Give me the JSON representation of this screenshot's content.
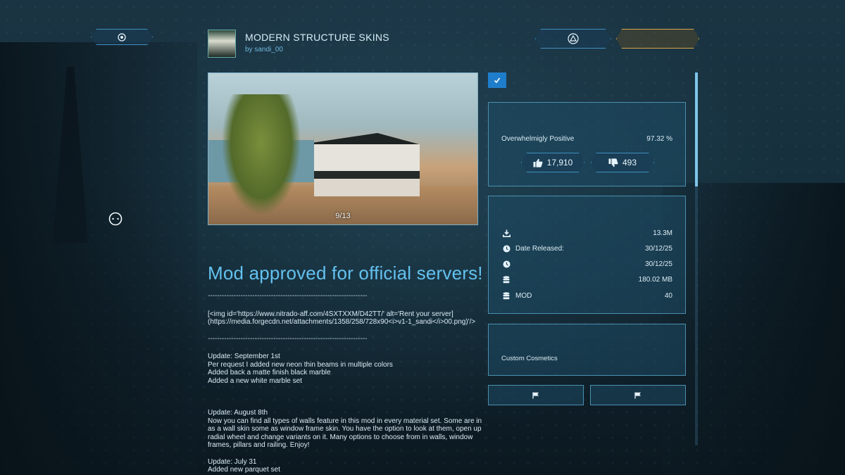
{
  "mod": {
    "title": "MODERN STRUCTURE SKINS",
    "author": "by sandi_00"
  },
  "preview": {
    "counter": "9/13"
  },
  "rating": {
    "label": "Overwhelmigly Positive",
    "percent": "97.32 %",
    "upvotes": "17,910",
    "downvotes": "493"
  },
  "stats": {
    "downloads": "13.3M",
    "date_released_label": "Date Released:",
    "date_released": "30/12/25",
    "date_updated": "30/12/25",
    "file_size": "180.02 MB",
    "mod_label": "MOD",
    "mod_value": "40"
  },
  "tags": {
    "category": "Custom Cosmetics"
  },
  "description": {
    "heading": "Mod approved for official servers!",
    "separator": "--------------------------------------------------------------------",
    "img_markup": "[<img id='https://www.nitrado-aff.com/4SXTXXM/D42TT/' alt='Rent your server](https://media.forgecdn.net/attachments/1358/258/728x90<i>v1-1_sandi</i>00.png)'/>",
    "update1_title": "Update: September 1st",
    "update1_lines": [
      "Per request I added new neon thin beams in multiple colors",
      "Added back a matte finish black marble",
      "Added a new white marble set"
    ],
    "update2_title": "Update: August 8th",
    "update2_text": "Now you can find all types of walls feature in this mod in every material set. Some are in as a wall skin some as window frame skin. You have the option to look at them, open up radial wheel and change variants on it. Many options to choose from in walls, window frames, pillars and railing. Enjoy!",
    "update3_title": "Update: July 31",
    "update3_lines": [
      "Added new parquet set"
    ]
  },
  "icons": {
    "top_left_button": "target-icon",
    "top_right_button": "triangle-icon",
    "thumbs_up": "thumbs-up-icon",
    "thumbs_down": "thumbs-down-icon",
    "flag": "flag-icon"
  },
  "colors": {
    "accent_blue": "#1f7ecb",
    "heading_blue": "#63c1ef",
    "panel_border": "#4a8fb0",
    "gold_border": "#d8a64a"
  }
}
